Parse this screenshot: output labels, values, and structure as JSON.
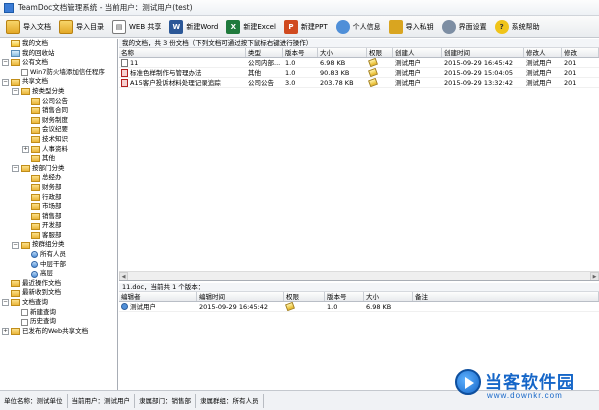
{
  "window": {
    "title": "TeamDoc文档管理系统 - 当前用户：测试用户(test)"
  },
  "toolbar": [
    {
      "label": "导入文档",
      "icon": "folder-import-icon",
      "cls": "ico-folder",
      "glyph": ""
    },
    {
      "label": "导入目录",
      "icon": "folder-open-icon",
      "cls": "ico-folder",
      "glyph": ""
    },
    {
      "label": "WEB 共享",
      "icon": "web-share-icon",
      "cls": "ico-web",
      "glyph": "▤"
    },
    {
      "label": "新建Word",
      "icon": "word-icon",
      "cls": "ico-word",
      "glyph": "W"
    },
    {
      "label": "新建Excel",
      "icon": "excel-icon",
      "cls": "ico-excel",
      "glyph": "X"
    },
    {
      "label": "新建PPT",
      "icon": "ppt-icon",
      "cls": "ico-ppt",
      "glyph": "P"
    },
    {
      "label": "个人信息",
      "icon": "user-info-icon",
      "cls": "ico-user",
      "glyph": ""
    },
    {
      "label": "导入私钥",
      "icon": "key-icon",
      "cls": "ico-key",
      "glyph": ""
    },
    {
      "label": "界面设置",
      "icon": "settings-icon",
      "cls": "ico-gear",
      "glyph": ""
    },
    {
      "label": "系统帮助",
      "icon": "help-icon",
      "cls": "ico-help",
      "glyph": "?"
    }
  ],
  "tree": [
    {
      "label": "我的文档",
      "level": 0,
      "toggle": "",
      "icon": "star"
    },
    {
      "label": "我的回收站",
      "level": 0,
      "toggle": "",
      "icon": "recycle"
    },
    {
      "label": "公有文档",
      "level": 0,
      "toggle": "−",
      "icon": "folder"
    },
    {
      "label": "Win7防火墙添加信任程序",
      "level": 1,
      "toggle": "",
      "icon": "doc"
    },
    {
      "label": "共享文档",
      "level": 0,
      "toggle": "−",
      "icon": "folder"
    },
    {
      "label": "按类型分类",
      "level": 1,
      "toggle": "−",
      "icon": "folder"
    },
    {
      "label": "公司公告",
      "level": 2,
      "toggle": "",
      "icon": "folder"
    },
    {
      "label": "销售合同",
      "level": 2,
      "toggle": "",
      "icon": "folder"
    },
    {
      "label": "财务制度",
      "level": 2,
      "toggle": "",
      "icon": "folder"
    },
    {
      "label": "会议纪要",
      "level": 2,
      "toggle": "",
      "icon": "folder"
    },
    {
      "label": "技术知识",
      "level": 2,
      "toggle": "",
      "icon": "folder"
    },
    {
      "label": "人事资料",
      "level": 2,
      "toggle": "+",
      "icon": "folder"
    },
    {
      "label": "其他",
      "level": 2,
      "toggle": "",
      "icon": "folder"
    },
    {
      "label": "按部门分类",
      "level": 1,
      "toggle": "−",
      "icon": "folder"
    },
    {
      "label": "总经办",
      "level": 2,
      "toggle": "",
      "icon": "folder"
    },
    {
      "label": "财务部",
      "level": 2,
      "toggle": "",
      "icon": "folder"
    },
    {
      "label": "行政部",
      "level": 2,
      "toggle": "",
      "icon": "folder"
    },
    {
      "label": "市场部",
      "level": 2,
      "toggle": "",
      "icon": "folder"
    },
    {
      "label": "销售部",
      "level": 2,
      "toggle": "",
      "icon": "folder"
    },
    {
      "label": "开发部",
      "level": 2,
      "toggle": "",
      "icon": "folder"
    },
    {
      "label": "客服部",
      "level": 2,
      "toggle": "",
      "icon": "folder"
    },
    {
      "label": "按群组分类",
      "level": 1,
      "toggle": "−",
      "icon": "folder"
    },
    {
      "label": "所有人员",
      "level": 2,
      "toggle": "",
      "icon": "person"
    },
    {
      "label": "中层干部",
      "level": 2,
      "toggle": "",
      "icon": "person"
    },
    {
      "label": "高层",
      "level": 2,
      "toggle": "",
      "icon": "person"
    },
    {
      "label": "最近操作文档",
      "level": 0,
      "toggle": "",
      "icon": "folder"
    },
    {
      "label": "最新收到文档",
      "level": 0,
      "toggle": "",
      "icon": "folder"
    },
    {
      "label": "文档查询",
      "level": 0,
      "toggle": "−",
      "icon": "folder"
    },
    {
      "label": "新建查询",
      "level": 1,
      "toggle": "",
      "icon": "doc"
    },
    {
      "label": "历史查询",
      "level": 1,
      "toggle": "",
      "icon": "doc"
    },
    {
      "label": "已发布的Web共享文档",
      "level": 0,
      "toggle": "+",
      "icon": "folder"
    }
  ],
  "upper": {
    "header": "我的文档，共 3 份文档（下列文档可通过按下鼠标右键进行操作）",
    "columns": [
      {
        "label": "名称",
        "w": 127
      },
      {
        "label": "类型",
        "w": 37
      },
      {
        "label": "版本号",
        "w": 35
      },
      {
        "label": "大小",
        "w": 49
      },
      {
        "label": "权限",
        "w": 26
      },
      {
        "label": "创建人",
        "w": 49
      },
      {
        "label": "创建时间",
        "w": 82
      },
      {
        "label": "修改人",
        "w": 38
      },
      {
        "label": "修改",
        "w": 37
      }
    ],
    "rows": [
      {
        "type_icon": "txt",
        "cells": [
          "11",
          "公司内部...",
          "1.0",
          "6.98 KB",
          "",
          "测试用户",
          "2015-09-29 16:45:42",
          "测试用户",
          "201"
        ]
      },
      {
        "type_icon": "pdf",
        "cells": [
          "标准色样制作与管理办法",
          "其他",
          "1.0",
          "90.83 KB",
          "",
          "测试用户",
          "2015-09-29 15:04:05",
          "测试用户",
          "201"
        ]
      },
      {
        "type_icon": "pdf",
        "cells": [
          "A15客户投诉材料处理记录追踪",
          "公司公告",
          "3.0",
          "203.78 KB",
          "",
          "测试用户",
          "2015-09-29 13:32:42",
          "测试用户",
          "201"
        ]
      }
    ]
  },
  "lower": {
    "header": "11.doc，当前共 1 个版本：",
    "columns": [
      {
        "label": "编辑者",
        "w": 78
      },
      {
        "label": "编辑时间",
        "w": 87
      },
      {
        "label": "权限",
        "w": 41
      },
      {
        "label": "版本号",
        "w": 39
      },
      {
        "label": "大小",
        "w": 49
      },
      {
        "label": "备注",
        "w": 186
      }
    ],
    "rows": [
      {
        "cells": [
          "测试用户",
          "2015-09-29 16:45:42",
          "",
          "1.0",
          "6.98 KB",
          ""
        ]
      }
    ]
  },
  "status": {
    "unit": "单位名称：测试单位",
    "user": "当前用户：测试用户",
    "dept": "隶属部门：销售部",
    "group": "隶属群组：所有人员"
  },
  "watermark": {
    "brand": "当客软件园",
    "url": "www.downkr.com"
  }
}
